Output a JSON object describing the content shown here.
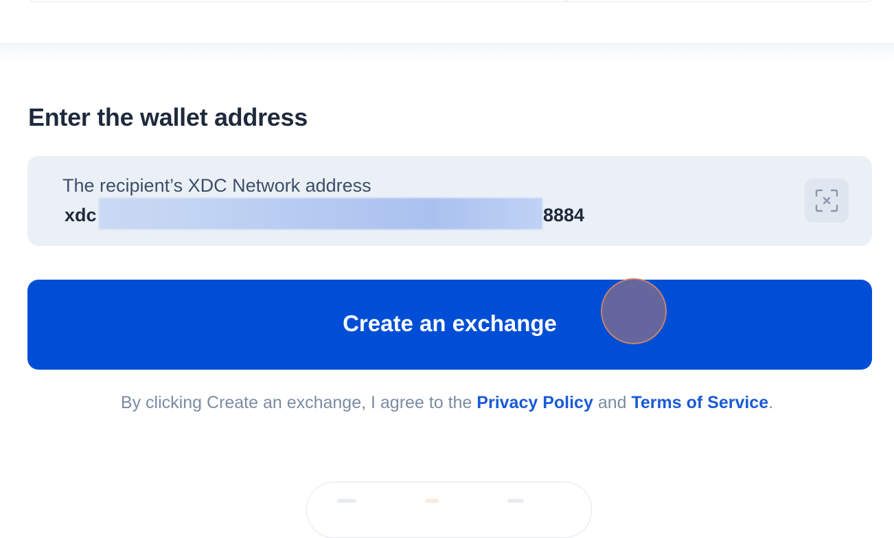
{
  "section": {
    "title": "Enter the wallet address"
  },
  "address_field": {
    "label": "The recipient’s XDC Network address",
    "value_prefix": "xdc",
    "value_suffix": "8884",
    "scan_icon": "qr-scan-icon"
  },
  "create_button": {
    "label": "Create an exchange"
  },
  "consent": {
    "prefix": "By clicking Create an exchange, I agree to the",
    "privacy_link": "Privacy Policy",
    "and_text": "and",
    "terms_link": "Terms of Service",
    "period": "."
  },
  "colors": {
    "primary": "#004ed6",
    "field_background": "#ebf0f7",
    "link": "#1a5ad6",
    "muted_text": "#7b8ba3",
    "heading_text": "#1f2a3c"
  }
}
